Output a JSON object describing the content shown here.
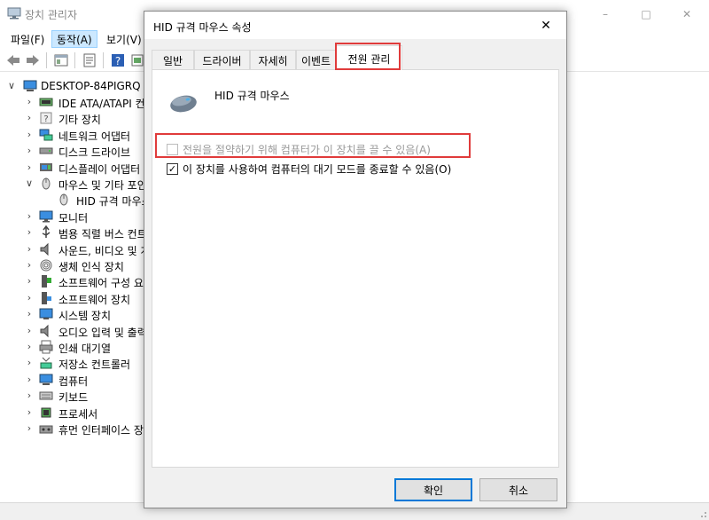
{
  "device_manager": {
    "title": "장치 관리자",
    "caption": {
      "minimize": "–",
      "maximize": "□",
      "close": "✕"
    },
    "menu": {
      "file": "파일(F)",
      "action": "동작(A)",
      "view": "보기(V)"
    },
    "tree": {
      "root": {
        "label": "DESKTOP-84PIGRQ",
        "expander": "∨"
      },
      "items": [
        {
          "label": "IDE ATA/ATAPI 컨트롤러",
          "expander": "›",
          "icon": "ide-controller-icon"
        },
        {
          "label": "기타 장치",
          "expander": "›",
          "icon": "unknown-device-icon"
        },
        {
          "label": "네트워크 어댑터",
          "expander": "›",
          "icon": "network-adapter-icon"
        },
        {
          "label": "디스크 드라이브",
          "expander": "›",
          "icon": "disk-drive-icon"
        },
        {
          "label": "디스플레이 어댑터",
          "expander": "›",
          "icon": "display-adapter-icon"
        },
        {
          "label": "마우스 및 기타 포인팅 장치",
          "expander": "∨",
          "icon": "mouse-icon"
        },
        {
          "label": "HID 규격 마우스",
          "expander": "",
          "icon": "mouse-icon",
          "child": true
        },
        {
          "label": "모니터",
          "expander": "›",
          "icon": "monitor-icon"
        },
        {
          "label": "범용 직렬 버스 컨트롤러",
          "expander": "›",
          "icon": "usb-icon"
        },
        {
          "label": "사운드, 비디오 및 게임 컨트롤러",
          "expander": "›",
          "icon": "speaker-icon"
        },
        {
          "label": "생체 인식 장치",
          "expander": "›",
          "icon": "fingerprint-icon"
        },
        {
          "label": "소프트웨어 구성 요소",
          "expander": "›",
          "icon": "software-component-icon"
        },
        {
          "label": "소프트웨어 장치",
          "expander": "›",
          "icon": "software-device-icon"
        },
        {
          "label": "시스템 장치",
          "expander": "›",
          "icon": "system-device-icon"
        },
        {
          "label": "오디오 입력 및 출력",
          "expander": "›",
          "icon": "speaker-icon"
        },
        {
          "label": "인쇄 대기열",
          "expander": "›",
          "icon": "printer-icon"
        },
        {
          "label": "저장소 컨트롤러",
          "expander": "›",
          "icon": "storage-controller-icon"
        },
        {
          "label": "컴퓨터",
          "expander": "›",
          "icon": "computer-icon"
        },
        {
          "label": "키보드",
          "expander": "›",
          "icon": "keyboard-icon"
        },
        {
          "label": "프로세서",
          "expander": "›",
          "icon": "processor-icon"
        },
        {
          "label": "휴먼 인터페이스 장치",
          "expander": "›",
          "icon": "hid-icon"
        }
      ]
    }
  },
  "dialog": {
    "title": "HID 규격 마우스 속성",
    "close": "✕",
    "tabs": {
      "general": "일반",
      "driver": "드라이버",
      "details": "자세히",
      "events": "이벤트",
      "power": "전원 관리"
    },
    "active_tab": "power",
    "device_name": "HID 규격 마우스",
    "options": {
      "allow_off": {
        "label": "전원을 절약하기 위해 컴퓨터가 이 장치를 끌 수 있음(A)",
        "checked": false,
        "disabled": true
      },
      "allow_wake": {
        "label": "이 장치를 사용하여 컴퓨터의 대기 모드를 종료할 수 있음(O)",
        "checked": true,
        "disabled": false,
        "check_mark": "✓"
      }
    },
    "buttons": {
      "ok": "확인",
      "cancel": "취소"
    }
  },
  "colors": {
    "highlight": "#e03b3b",
    "menu_active": "#cce8ff",
    "button_focus": "#0078d7"
  }
}
